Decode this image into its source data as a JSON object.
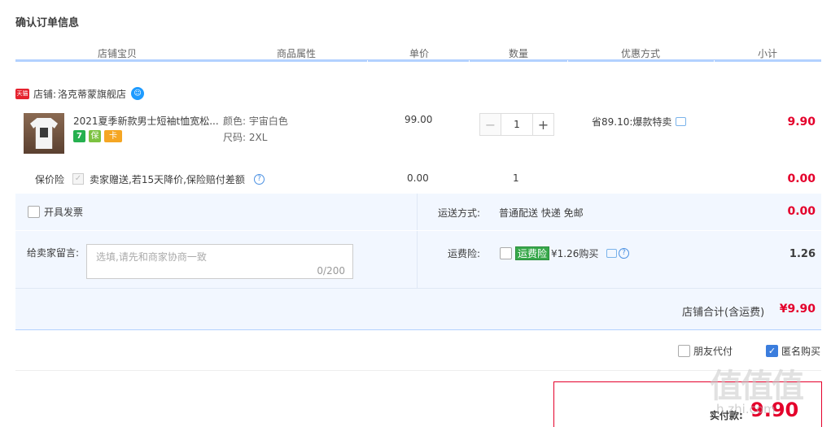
{
  "page_title": "确认订单信息",
  "columns": [
    "店铺宝贝",
    "商品属性",
    "单价",
    "数量",
    "优惠方式",
    "小计"
  ],
  "shop": {
    "badge": "天猫",
    "label": "店铺:",
    "name": "洛克蒂蒙旗舰店",
    "ww_icon": "chat-bubble-icon"
  },
  "item": {
    "title": "2021夏季新款男士短袖t恤宽松...",
    "service_icons": [
      "7",
      "保",
      "卡"
    ],
    "attrs": {
      "color": "颜色: 宇宙白色",
      "size": "尺码: 2XL"
    },
    "price": "99.00",
    "quantity": "1",
    "minus": "−",
    "plus": "+",
    "discount": "省89.10:爆款特卖",
    "subtotal": "9.90"
  },
  "insurance": {
    "label": "保价险",
    "check": "✓",
    "desc": "卖家赠送,若15天降价,保险赔付差额",
    "help": "?",
    "price": "0.00",
    "qty": "1",
    "subtotal": "0.00"
  },
  "invoice": {
    "label": "开具发票"
  },
  "message": {
    "label": "给卖家留言:",
    "placeholder": "选填,请先和商家协商一致",
    "count": "0/200"
  },
  "shipping": {
    "label": "运送方式:",
    "method": "普通配送 快递 免邮",
    "fee": "0.00"
  },
  "freight_insurance": {
    "label": "运费险:",
    "tag": "运费险",
    "buy": "¥1.26购买",
    "help": "?",
    "price": "1.26"
  },
  "shop_total": {
    "label": "店铺合计(含运费)",
    "value": "¥9.90"
  },
  "options": {
    "friend_pay": "朋友代付",
    "anonymous": "匿名购买",
    "anonymous_check": "✓"
  },
  "payment": {
    "label": "实付款:",
    "value": "9.90"
  },
  "watermark": {
    "text": "值值值",
    "url": "h.zhi.com"
  },
  "colors": {
    "accent_red": "#e4002b",
    "header_blue": "#b2d1ff",
    "panel_bg": "#f2f7ff"
  }
}
